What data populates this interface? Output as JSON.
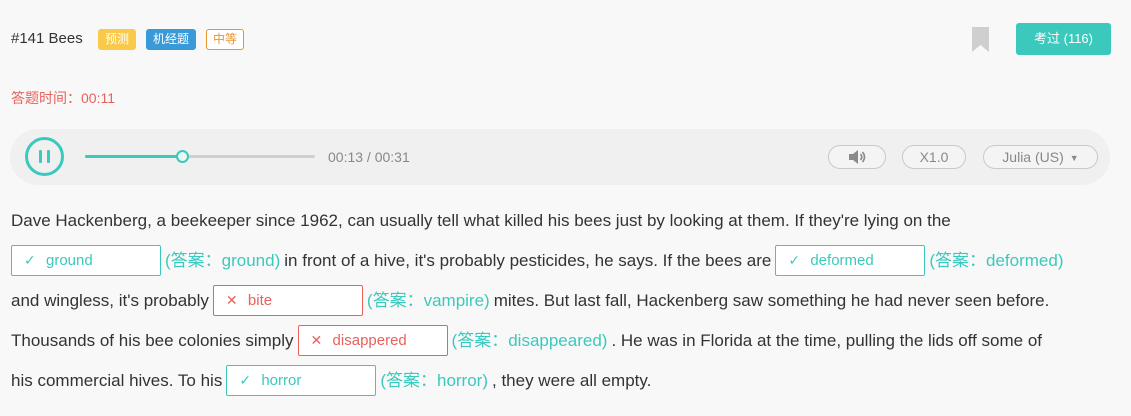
{
  "header": {
    "title": "#141 Bees",
    "tags": [
      {
        "label": "预测",
        "color": "#f9c94a"
      },
      {
        "label": "机经题",
        "color": "#3a9ad9"
      },
      {
        "label": "中等",
        "color": "#e8962b"
      }
    ],
    "pass_button": "考过 (116)"
  },
  "timer": "答题时间：00:11",
  "player": {
    "time": "00:13 / 00:31",
    "progress": 0.42,
    "speed": "X1.0",
    "voice": "Julia (US)"
  },
  "passage": {
    "line1": "Dave Hackenberg, a beekeeper since 1962, can usually tell what killed his bees just by looking at them. If they're lying on the",
    "seg_after_1": "in front of a hive, it's probably pesticides, he says. If the bees are",
    "seg_before_3": "and wingless, it's probably",
    "seg_after_3": "mites. But last fall, Hackenberg saw something he had never seen before.",
    "seg_before_4": "Thousands of his bee colonies simply",
    "seg_after_4": ". He was in Florida at the time, pulling the lids off some of",
    "seg_before_5": "his commercial hives. To his",
    "seg_after_5": ", they were all empty."
  },
  "blanks": [
    {
      "value": "ground",
      "answer": "(答案：ground)",
      "correct": true
    },
    {
      "value": "deformed",
      "answer": "(答案：deformed)",
      "correct": true
    },
    {
      "value": "bite",
      "answer": "(答案：vampire)",
      "correct": false
    },
    {
      "value": "disappered",
      "answer": "(答案：disappeared)",
      "correct": false
    },
    {
      "value": "horror",
      "answer": "(答案：horror)",
      "correct": true
    }
  ],
  "colors": {
    "accent": "#3bc9bd",
    "error": "#e8615b",
    "tag_yellow": "#f9c94a",
    "tag_blue": "#3a9ad9",
    "tag_orange": "#e8962b"
  }
}
